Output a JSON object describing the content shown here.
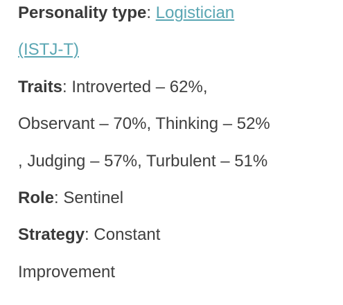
{
  "personality": {
    "label": "Personality type",
    "sep": ": ",
    "link_part1": "Logistician",
    "link_part2": "(ISTJ-T)"
  },
  "traits": {
    "label": "Traits",
    "sep": ": ",
    "line1": "Introverted – 62%,",
    "line2": "Observant – 70%, Thinking – 52%",
    "line3": ", Judging – 57%, Turbulent – 51%"
  },
  "role": {
    "label": "Role",
    "sep": ": ",
    "value": "Sentinel"
  },
  "strategy": {
    "label": "Strategy",
    "sep": ": ",
    "value_line1": "Constant",
    "value_line2": "Improvement"
  },
  "colors": {
    "text": "#3f3f3f",
    "link": "#5aa6b3"
  }
}
